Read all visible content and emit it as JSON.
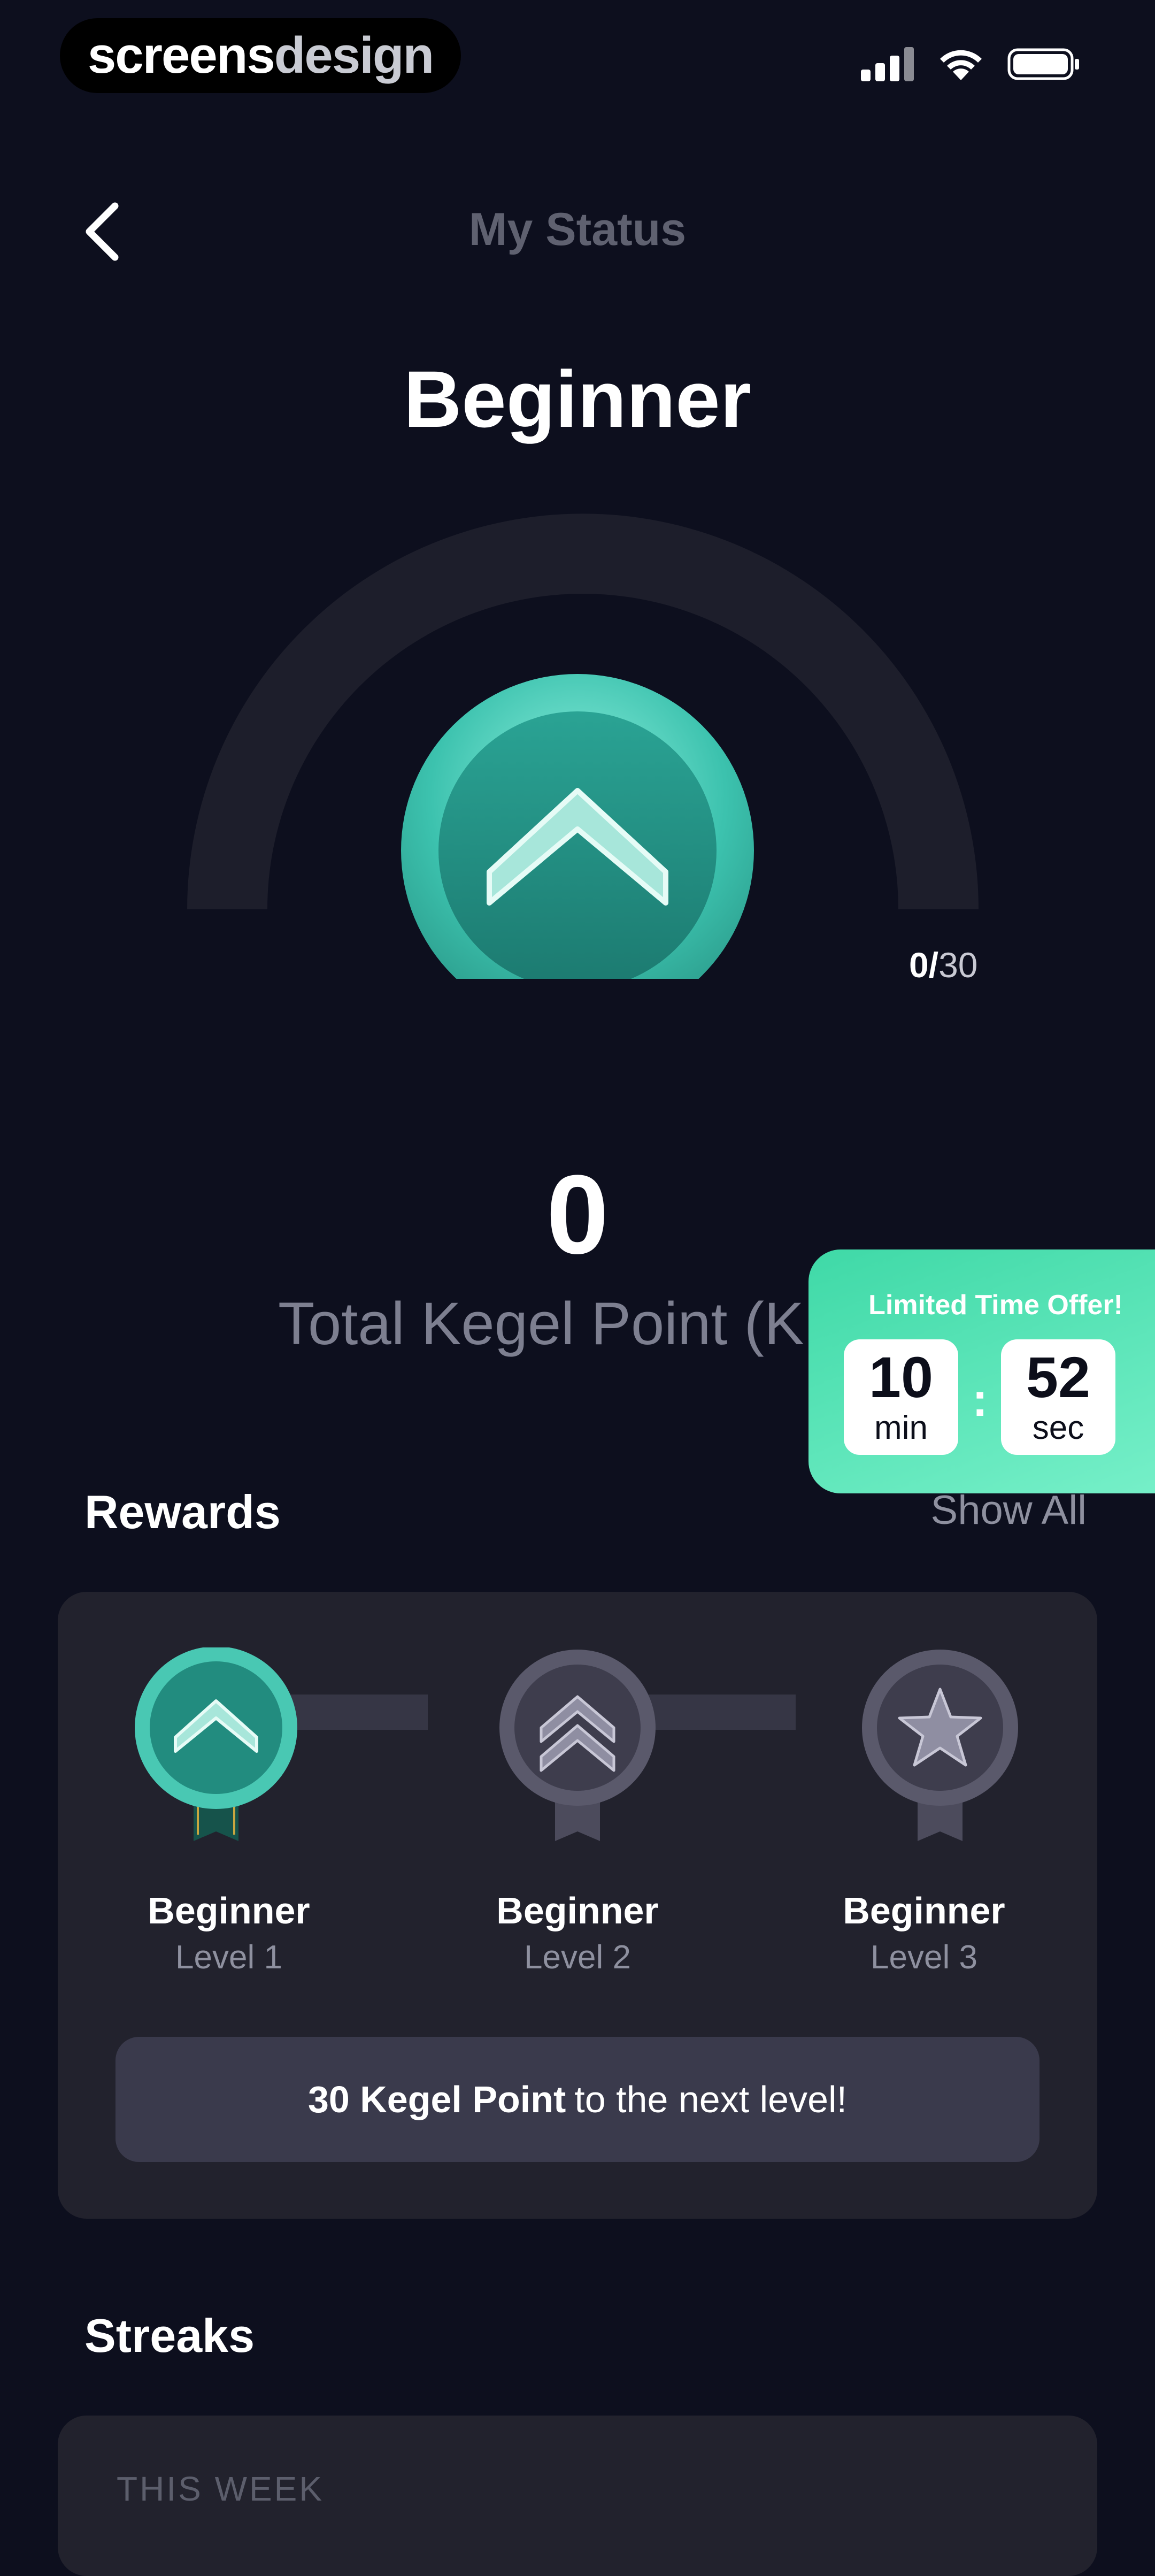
{
  "brand": {
    "part1": "screens",
    "part2": "design"
  },
  "header": {
    "title": "My Status"
  },
  "status": {
    "level_name": "Beginner",
    "progress_current": "0",
    "progress_total": "30",
    "progress_fraction": 0,
    "total_points": "0",
    "points_label": "Total Kegel Point (K"
  },
  "offer": {
    "title": "Limited Time Offer!",
    "minutes": "10",
    "minutes_unit": "min",
    "seconds": "52",
    "seconds_unit": "sec",
    "separator": ":"
  },
  "rewards": {
    "title": "Rewards",
    "show_all": "Show All",
    "levels": [
      {
        "name": "Beginner",
        "level": "Level 1",
        "state": "unlocked",
        "icon": "chevron-up-icon"
      },
      {
        "name": "Beginner",
        "level": "Level 2",
        "state": "locked",
        "icon": "double-chevron-icon"
      },
      {
        "name": "Beginner",
        "level": "Level 3",
        "state": "locked",
        "icon": "star-icon"
      }
    ],
    "next_level_bold": "30 Kegel Point",
    "next_level_rest": "to the next level!"
  },
  "streaks": {
    "title": "Streaks",
    "this_week": "THIS WEEK"
  },
  "colors": {
    "background": "#0d0f1e",
    "accent": "#3fd9a7",
    "card": "#22222d",
    "badge_teal": "#2a9c8e"
  }
}
